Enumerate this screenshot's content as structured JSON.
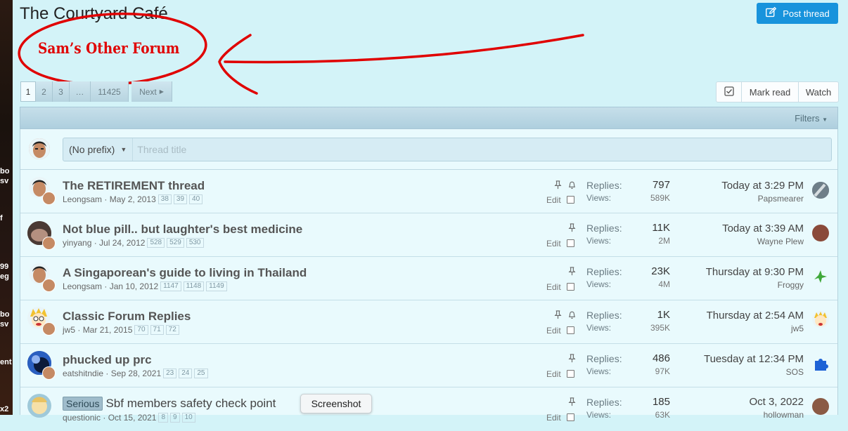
{
  "side_strip": {
    "fragments": [
      "bo",
      "sv",
      "f",
      "99",
      "eg",
      "bo",
      "sv",
      "ent",
      "x2"
    ]
  },
  "header": {
    "title": "The Courtyard Café",
    "post_thread_label": "Post thread",
    "post_icon": "edit-square-icon"
  },
  "annotation": {
    "text": "Sam’s Other Forum",
    "color": "#e00000"
  },
  "pagination": {
    "pages": [
      "1",
      "2",
      "3",
      "…",
      "11425"
    ],
    "current": "1",
    "next_label": "Next"
  },
  "actions": {
    "mark_read": "Mark read",
    "watch": "Watch"
  },
  "filters": {
    "label": "Filters"
  },
  "quick_thread": {
    "prefix": "(No prefix)",
    "title_placeholder": "Thread title"
  },
  "threads": [
    {
      "title": "The RETIREMENT thread",
      "prefix": "",
      "author": "Leongsam",
      "date": "May 2, 2013",
      "pages": [
        "38",
        "39",
        "40"
      ],
      "sticky": true,
      "watched": true,
      "edit": "Edit",
      "replies_label": "Replies:",
      "replies": "797",
      "views_label": "Views:",
      "views": "589K",
      "last_time": "Today at 3:29 PM",
      "last_user": "Papsmearer"
    },
    {
      "title": "Not blue pill.. but laughter's best medicine",
      "prefix": "",
      "author": "yinyang",
      "date": "Jul 24, 2012",
      "pages": [
        "528",
        "529",
        "530"
      ],
      "sticky": true,
      "watched": false,
      "edit": "Edit",
      "replies_label": "Replies:",
      "replies": "11K",
      "views_label": "Views:",
      "views": "2M",
      "last_time": "Today at 3:39 AM",
      "last_user": "Wayne Plew"
    },
    {
      "title": "A Singaporean's guide to living in Thailand",
      "prefix": "",
      "author": "Leongsam",
      "date": "Jan 10, 2012",
      "pages": [
        "1147",
        "1148",
        "1149"
      ],
      "sticky": true,
      "watched": false,
      "edit": "Edit",
      "replies_label": "Replies:",
      "replies": "23K",
      "views_label": "Views:",
      "views": "4M",
      "last_time": "Thursday at 9:30 PM",
      "last_user": "Froggy"
    },
    {
      "title": "Classic Forum Replies",
      "prefix": "",
      "author": "jw5",
      "date": "Mar 21, 2015",
      "pages": [
        "70",
        "71",
        "72"
      ],
      "sticky": true,
      "watched": true,
      "edit": "Edit",
      "replies_label": "Replies:",
      "replies": "1K",
      "views_label": "Views:",
      "views": "395K",
      "last_time": "Thursday at 2:54 AM",
      "last_user": "jw5"
    },
    {
      "title": "phucked up prc",
      "prefix": "",
      "author": "eatshitndie",
      "date": "Sep 28, 2021",
      "pages": [
        "23",
        "24",
        "25"
      ],
      "sticky": true,
      "watched": false,
      "edit": "Edit",
      "replies_label": "Replies:",
      "replies": "486",
      "views_label": "Views:",
      "views": "97K",
      "last_time": "Tuesday at 12:34 PM",
      "last_user": "SOS"
    },
    {
      "title": "Sbf members safety check point",
      "prefix": "Serious",
      "author": "questionic",
      "date": "Oct 15, 2021",
      "pages": [
        "8",
        "9",
        "10"
      ],
      "sticky": true,
      "watched": false,
      "edit": "Edit",
      "replies_label": "Replies:",
      "replies": "185",
      "views_label": "Views:",
      "views": "63K",
      "last_time": "Oct 3, 2022",
      "last_user": "hollowman"
    }
  ],
  "tooltip": {
    "text": "Screenshot"
  }
}
